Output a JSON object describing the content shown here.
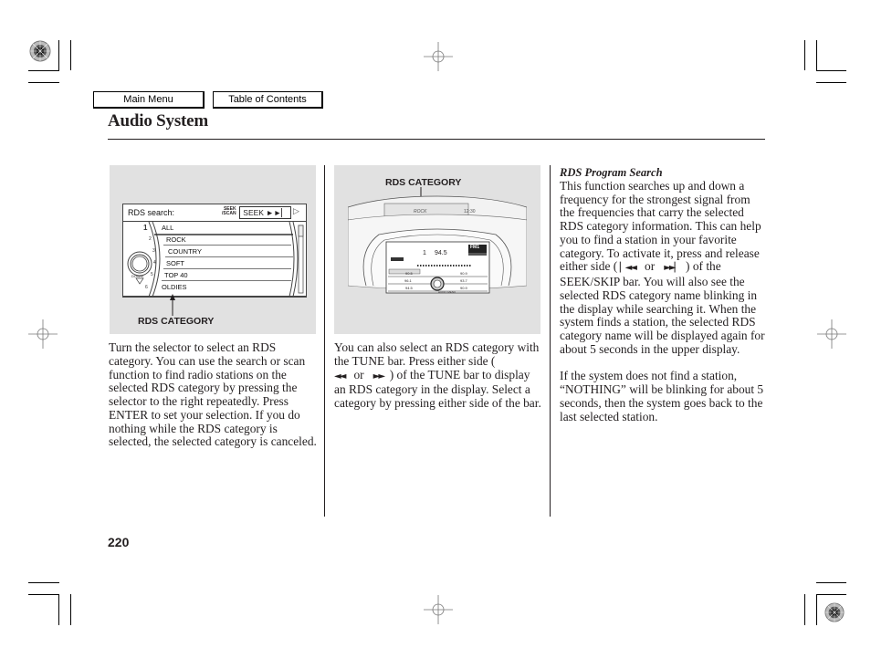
{
  "nav": {
    "main_menu": "Main Menu",
    "table_of_contents": "Table of Contents"
  },
  "header": {
    "title": "Audio System"
  },
  "figure1": {
    "screen_title": "RDS search:",
    "seek_scan_label_1": "SEEK",
    "seek_scan_label_2": "/SCAN",
    "seek_button": "SEEK ►►▏",
    "categories": [
      {
        "num": "1",
        "label": "ALL"
      },
      {
        "num": "2",
        "label": "ROCK"
      },
      {
        "num": "3",
        "label": "COUNTRY"
      },
      {
        "num": "4",
        "label": "SOFT"
      },
      {
        "num": "5",
        "label": "TOP 40"
      },
      {
        "num": "6",
        "label": "OLDIES"
      }
    ],
    "down_label": "DOWN",
    "callout": "RDS CATEGORY"
  },
  "figure2": {
    "callout": "RDS CATEGORY",
    "upper_display_left": "ROCK",
    "upper_display_right": "12:30",
    "preset": "1",
    "frequency": "94.5",
    "band": "FM1",
    "presets_left": [
      "90.5",
      "96.1",
      "94.5"
    ],
    "presets_right": [
      "90.9",
      "93.7",
      "90.9"
    ],
    "audio_menu": "AUDIO MENU"
  },
  "column1": {
    "text": "Turn the selector to select an RDS category. You can use the search or scan function to find radio stations on the selected RDS category by pressing the selector to the right repeatedly. Press ENTER to set your selection. If you do nothing while the RDS category is selected, the selected category is canceled."
  },
  "column2": {
    "text_before": "You can also select an RDS category with the TUNE bar. Press either side (",
    "icon_left": "◄◄",
    "or": "or",
    "icon_right": "►►",
    "text_after": ") of the TUNE bar to display an RDS category in the display. Select a category by pressing either side of the bar."
  },
  "column3": {
    "subheading": "RDS Program Search",
    "para1_before": "This function searches up and down a frequency for the strongest signal from the frequencies that carry the selected RDS category information. This can help you to find a station in your favorite category. To activate it, press and release either side (",
    "icon_left": "▏◄◄",
    "or": "or",
    "icon_right": "►►▏",
    "para1_after": ") of the SEEK/SKIP bar. You will also see the selected RDS category name blinking in the display while searching it. When the system finds a station, the selected RDS category name will be displayed again for about 5 seconds in the upper display.",
    "para2": "If the system does not find a station, “NOTHING” will be blinking for about 5 seconds, then the system goes back to the last selected station."
  },
  "footer": {
    "page_number": "220"
  }
}
